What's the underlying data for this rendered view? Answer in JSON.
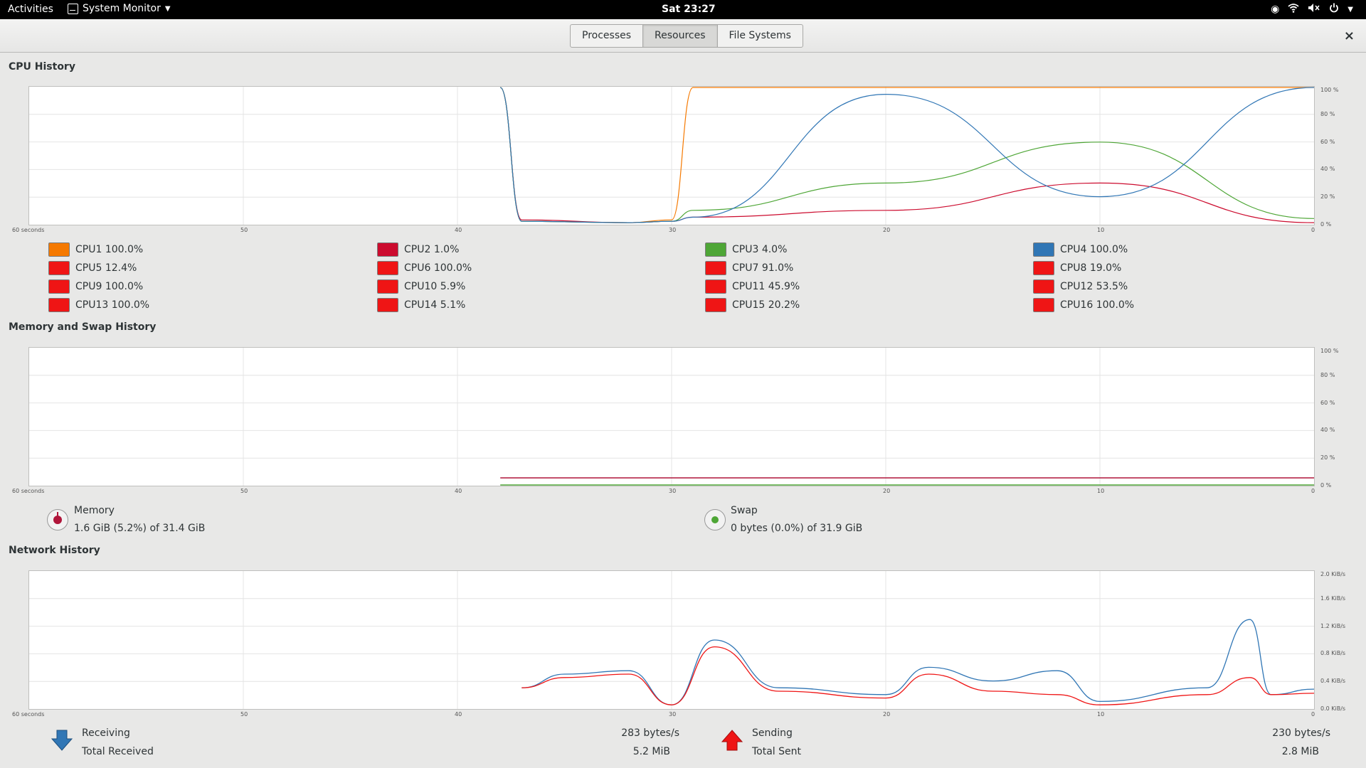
{
  "topbar": {
    "activities": "Activities",
    "app_name": "System Monitor",
    "clock": "Sat 23:27",
    "tray_icons": [
      "record-icon",
      "wifi-icon",
      "volume-muted-icon",
      "power-icon",
      "chevron-down-icon"
    ]
  },
  "header": {
    "tabs": [
      {
        "label": "Processes"
      },
      {
        "label": "Resources"
      },
      {
        "label": "File Systems"
      }
    ],
    "close": "×"
  },
  "cpu": {
    "title": "CPU History",
    "x_ticks": [
      "60 seconds",
      "50",
      "40",
      "30",
      "20",
      "10",
      "0"
    ],
    "y_ticks": [
      "100 %",
      "80 %",
      "60 %",
      "40 %",
      "20 %",
      "0 %"
    ],
    "legend": [
      {
        "label": "CPU1 100.0%",
        "color": "#f57900"
      },
      {
        "label": "CPU2 1.0%",
        "color": "#cc0b2e"
      },
      {
        "label": "CPU3 4.0%",
        "color": "#4ea636"
      },
      {
        "label": "CPU4 100.0%",
        "color": "#3076b5"
      },
      {
        "label": "CPU5 12.4%",
        "color": "#ef1515"
      },
      {
        "label": "CPU6 100.0%",
        "color": "#ef1515"
      },
      {
        "label": "CPU7 91.0%",
        "color": "#ef1515"
      },
      {
        "label": "CPU8 19.0%",
        "color": "#ef1515"
      },
      {
        "label": "CPU9 100.0%",
        "color": "#ef1515"
      },
      {
        "label": "CPU10 5.9%",
        "color": "#ef1515"
      },
      {
        "label": "CPU11 45.9%",
        "color": "#ef1515"
      },
      {
        "label": "CPU12 53.5%",
        "color": "#ef1515"
      },
      {
        "label": "CPU13 100.0%",
        "color": "#ef1515"
      },
      {
        "label": "CPU14 5.1%",
        "color": "#ef1515"
      },
      {
        "label": "CPU15 20.2%",
        "color": "#ef1515"
      },
      {
        "label": "CPU16 100.0%",
        "color": "#ef1515"
      }
    ]
  },
  "memory": {
    "title": "Memory and Swap History",
    "x_ticks": [
      "60 seconds",
      "50",
      "40",
      "30",
      "20",
      "10",
      "0"
    ],
    "y_ticks": [
      "100 %",
      "80 %",
      "60 %",
      "40 %",
      "20 %",
      "0 %"
    ],
    "memory_label": "Memory",
    "memory_value": "1.6 GiB (5.2%) of 31.4 GiB",
    "memory_fraction": 0.052,
    "memory_color": "#b0153a",
    "swap_label": "Swap",
    "swap_value": "0 bytes (0.0%) of 31.9 GiB",
    "swap_fraction": 0.0,
    "swap_color": "#4ea636"
  },
  "network": {
    "title": "Network History",
    "x_ticks": [
      "60 seconds",
      "50",
      "40",
      "30",
      "20",
      "10",
      "0"
    ],
    "y_ticks": [
      "2.0 KiB/s",
      "1.6 KiB/s",
      "1.2 KiB/s",
      "0.8 KiB/s",
      "0.4 KiB/s",
      "0.0 KiB/s"
    ],
    "receiving_label": "Receiving",
    "receiving_rate": "283 bytes/s",
    "total_received_label": "Total Received",
    "total_received": "5.2 MiB",
    "sending_label": "Sending",
    "sending_rate": "230 bytes/s",
    "total_sent_label": "Total Sent",
    "total_sent": "2.8 MiB",
    "receiving_color": "#3076b5",
    "sending_color": "#ef1515"
  },
  "chart_data": [
    {
      "type": "line",
      "title": "CPU History",
      "xlabel": "seconds",
      "ylabel": "%",
      "x": [
        60,
        50,
        40,
        38,
        37,
        32,
        30,
        29,
        20,
        10,
        0
      ],
      "ylim": [
        0,
        100
      ],
      "series": [
        {
          "name": "CPU1",
          "values": [
            null,
            null,
            null,
            100,
            2,
            1,
            3,
            100,
            100,
            100,
            100
          ]
        },
        {
          "name": "CPU2",
          "values": [
            null,
            null,
            null,
            100,
            3,
            1,
            2,
            5,
            10,
            30,
            1
          ]
        },
        {
          "name": "CPU3",
          "values": [
            null,
            null,
            null,
            100,
            2,
            1,
            2,
            10,
            30,
            60,
            4
          ]
        },
        {
          "name": "CPU4",
          "values": [
            null,
            null,
            null,
            100,
            2,
            1,
            2,
            5,
            95,
            20,
            100
          ]
        }
      ]
    },
    {
      "type": "line",
      "title": "Memory and Swap History",
      "x": [
        60,
        50,
        40,
        38,
        30,
        20,
        10,
        0
      ],
      "ylim": [
        0,
        100
      ],
      "series": [
        {
          "name": "Memory",
          "values": [
            null,
            null,
            null,
            5.2,
            5.2,
            5.2,
            5.2,
            5.2
          ]
        },
        {
          "name": "Swap",
          "values": [
            null,
            null,
            null,
            0,
            0,
            0,
            0,
            0
          ]
        }
      ]
    },
    {
      "type": "line",
      "title": "Network History",
      "x": [
        37,
        35,
        32,
        30,
        28,
        25,
        20,
        18,
        15,
        12,
        10,
        5,
        3,
        2,
        0
      ],
      "ylim": [
        0,
        2.0
      ],
      "series": [
        {
          "name": "Receiving",
          "values": [
            0.3,
            0.5,
            0.55,
            0.05,
            1.0,
            0.3,
            0.2,
            0.6,
            0.4,
            0.55,
            0.1,
            0.3,
            1.3,
            0.2,
            0.28
          ]
        },
        {
          "name": "Sending",
          "values": [
            0.3,
            0.45,
            0.5,
            0.05,
            0.9,
            0.25,
            0.15,
            0.5,
            0.25,
            0.2,
            0.05,
            0.2,
            0.45,
            0.2,
            0.22
          ]
        }
      ]
    }
  ]
}
